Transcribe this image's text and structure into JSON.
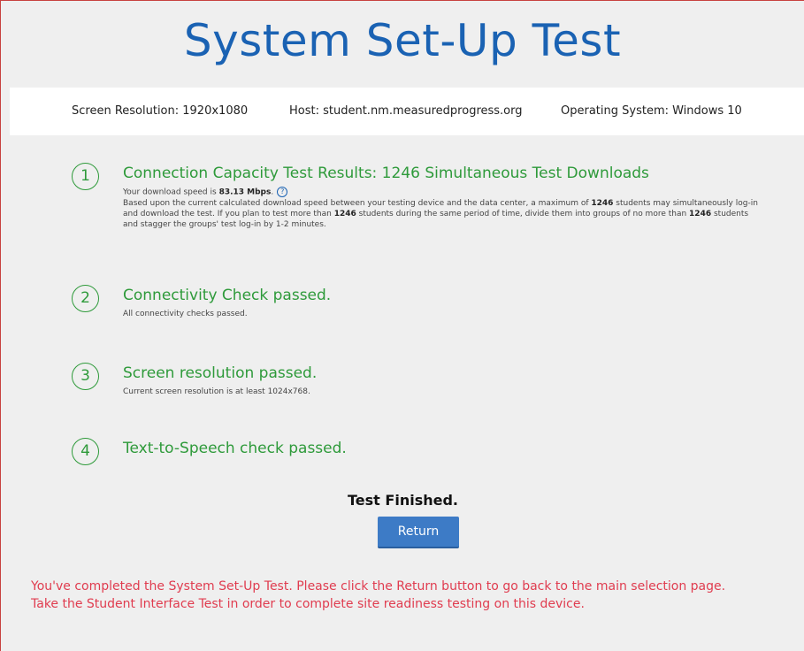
{
  "header": {
    "title": "System Set-Up Test"
  },
  "info_bar": {
    "screen_resolution": "Screen Resolution: 1920x1080",
    "host": "Host: student.nm.measuredprogress.org",
    "os": "Operating System: Windows 10"
  },
  "steps": [
    {
      "number": "1",
      "title": "Connection Capacity Test Results: 1246 Simultaneous Test Downloads",
      "speed_prefix": "Your download speed is ",
      "speed_value": "83.13 Mbps",
      "speed_suffix": ".",
      "details_1": "Based upon the current calculated download speed between your testing device and the data center, a maximum of ",
      "students_1": "1246",
      "details_2": " students may simultaneously log-in and download the test. If you plan to test more than ",
      "students_2": "1246",
      "details_3": " students during the same period of time, divide them into groups of no more than ",
      "students_3": "1246",
      "details_4": " students and stagger the groups' test log-in by 1-2 minutes."
    },
    {
      "number": "2",
      "title": "Connectivity Check passed.",
      "subtitle": "All connectivity checks passed."
    },
    {
      "number": "3",
      "title": "Screen resolution passed.",
      "subtitle": "Current screen resolution is at least 1024x768."
    },
    {
      "number": "4",
      "title": "Text-to-Speech check passed."
    }
  ],
  "status": {
    "finished": "Test Finished.",
    "return_label": "Return"
  },
  "notice": {
    "line1": "You've completed the System Set-Up Test. Please click the Return button to go back to the main selection page.",
    "line2": "Take the Student Interface Test in order to complete site readiness testing on this device."
  },
  "colors": {
    "title_blue": "#1a62b3",
    "pass_green": "#2e9a3a",
    "button_blue": "#3d7bc6",
    "notice_red": "#e03c4f"
  },
  "icons": {
    "help": "help-icon"
  }
}
